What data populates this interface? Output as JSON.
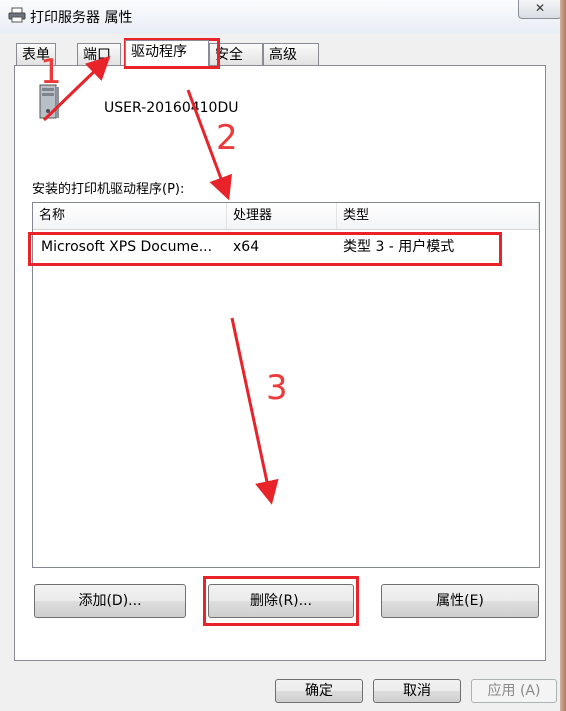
{
  "window": {
    "title": "打印服务器 属性",
    "close_glyph": "✕",
    "title_icon": "printer-icon"
  },
  "tabs": [
    {
      "label": "表单",
      "active": false
    },
    {
      "label": "端口",
      "active": false
    },
    {
      "label": "驱动程序",
      "active": true
    },
    {
      "label": "安全",
      "active": false
    },
    {
      "label": "高级",
      "active": false
    }
  ],
  "server": {
    "name": "USER-20160410DU",
    "icon": "server-computer-icon"
  },
  "drivers": {
    "label": "安装的打印机驱动程序(P):",
    "columns": [
      "名称",
      "处理器",
      "类型"
    ],
    "rows": [
      {
        "name": "Microsoft XPS Docume...",
        "processor": "x64",
        "type": "类型 3 - 用户模式"
      }
    ]
  },
  "actions": {
    "add": "添加(D)...",
    "remove": "删除(R)...",
    "properties": "属性(E)"
  },
  "footer": {
    "ok": "确定",
    "cancel": "取消",
    "apply": "应用 (A)"
  },
  "annotations": {
    "step1": "1",
    "step2": "2",
    "step3": "3",
    "color": "#e8242a"
  }
}
